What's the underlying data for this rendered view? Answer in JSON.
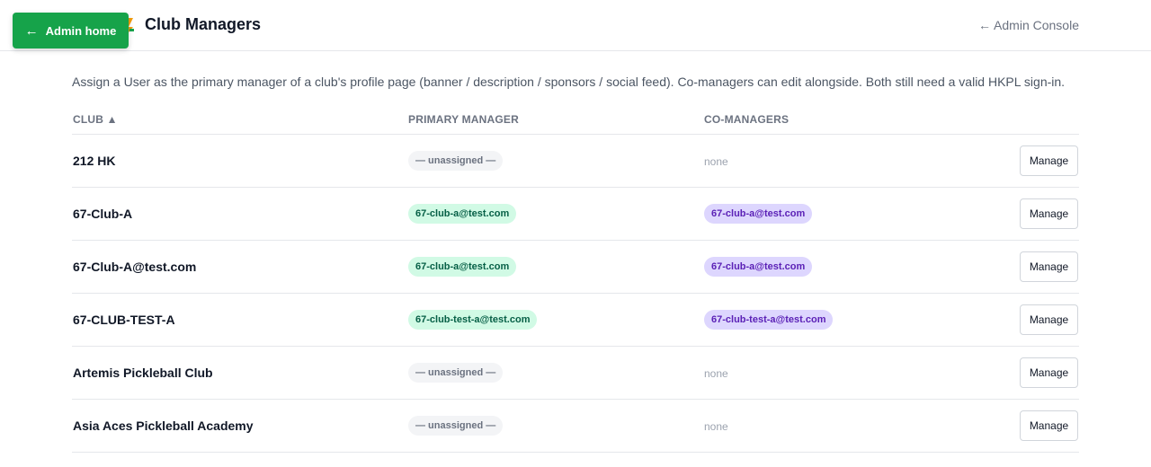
{
  "header": {
    "title": "Club Managers",
    "admin_console_link": "← Admin Console",
    "admin_home_label": "Admin home",
    "admin_home_arrow": "←"
  },
  "description": "Assign a User as the primary manager of a club's profile page (banner / description / sponsors / social feed). Co-managers can edit alongside. Both still need a valid HKPL sign-in.",
  "table": {
    "headers": {
      "club": "CLUB ▲",
      "primary_manager": "PRIMARY MANAGER",
      "co_managers": "CO-MANAGERS"
    },
    "manage_label": "Manage",
    "none_label": "none",
    "unassigned_label": "— unassigned —",
    "rows": [
      {
        "club": "212 HK",
        "primary": "— unassigned —",
        "co": "none"
      },
      {
        "club": "67-Club-A",
        "primary": "67-club-a@test.com",
        "co": "67-club-a@test.com"
      },
      {
        "club": "67-Club-A@test.com",
        "primary": "67-club-a@test.com",
        "co": "67-club-a@test.com"
      },
      {
        "club": "67-CLUB-TEST-A",
        "primary": "67-club-test-a@test.com",
        "co": "67-club-test-a@test.com"
      },
      {
        "club": "Artemis Pickleball Club",
        "primary": "— unassigned —",
        "co": "none"
      },
      {
        "club": "Asia Aces Pickleball Academy",
        "primary": "— unassigned —",
        "co": "none"
      }
    ]
  },
  "colors": {
    "accent_green": "#16a34a",
    "primary_chip_bg": "#d1fae5",
    "co_chip_bg": "#ddd6fe"
  }
}
